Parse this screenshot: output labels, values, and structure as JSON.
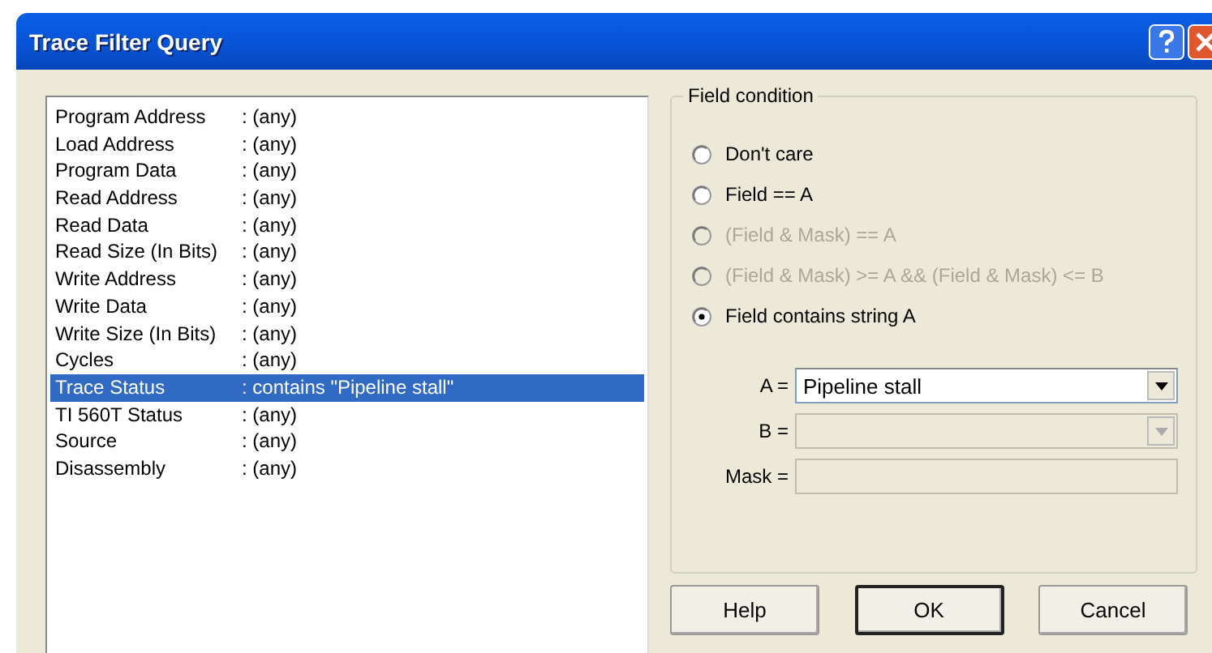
{
  "window": {
    "title": "Trace Filter Query"
  },
  "fields": [
    {
      "name": "Program Address",
      "condition": ": (any)",
      "selected": false
    },
    {
      "name": "Load Address",
      "condition": ": (any)",
      "selected": false
    },
    {
      "name": "Program Data",
      "condition": ": (any)",
      "selected": false
    },
    {
      "name": "Read Address",
      "condition": ": (any)",
      "selected": false
    },
    {
      "name": "Read Data",
      "condition": ": (any)",
      "selected": false
    },
    {
      "name": "Read Size (In Bits)",
      "condition": ": (any)",
      "selected": false
    },
    {
      "name": "Write Address",
      "condition": ": (any)",
      "selected": false
    },
    {
      "name": "Write Data",
      "condition": ": (any)",
      "selected": false
    },
    {
      "name": "Write Size (In Bits)",
      "condition": ": (any)",
      "selected": false
    },
    {
      "name": "Cycles",
      "condition": ": (any)",
      "selected": false
    },
    {
      "name": "Trace Status",
      "condition": ": contains \"Pipeline stall\"",
      "selected": true
    },
    {
      "name": "TI 560T Status",
      "condition": ": (any)",
      "selected": false
    },
    {
      "name": "Source",
      "condition": ": (any)",
      "selected": false
    },
    {
      "name": "Disassembly",
      "condition": ": (any)",
      "selected": false
    }
  ],
  "field_condition": {
    "title": "Field condition",
    "options": [
      {
        "label": "Don't care",
        "selected": false,
        "disabled": false
      },
      {
        "label": "Field == A",
        "selected": false,
        "disabled": false
      },
      {
        "label": "(Field & Mask) == A",
        "selected": false,
        "disabled": true
      },
      {
        "label": "(Field & Mask) >= A  && (Field & Mask) <= B",
        "selected": false,
        "disabled": true
      },
      {
        "label": "Field contains string A",
        "selected": true,
        "disabled": false
      }
    ],
    "inputs": [
      {
        "label": "A =",
        "kind": "combo",
        "value": "Pipeline stall",
        "disabled": false
      },
      {
        "label": "B =",
        "kind": "combo",
        "disabled": true
      },
      {
        "label": "Mask =",
        "kind": "text",
        "disabled": true
      }
    ]
  },
  "buttons": [
    {
      "label": "Help",
      "default": false
    },
    {
      "label": "OK",
      "default": true
    },
    {
      "label": "Cancel",
      "default": false
    }
  ]
}
